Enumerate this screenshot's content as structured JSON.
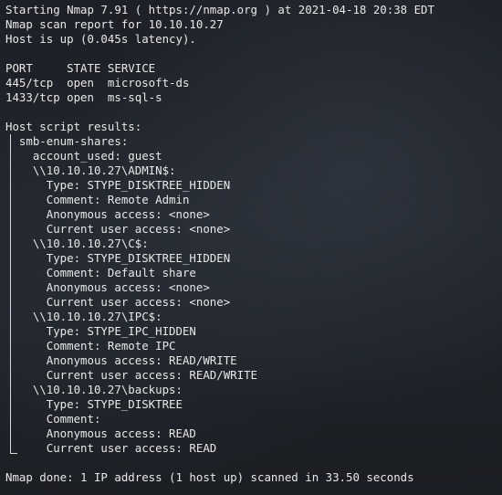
{
  "terminal": {
    "lines": {
      "l1": "Starting Nmap 7.91 ( https://nmap.org ) at 2021-04-18 20:38 EDT",
      "l2": "Nmap scan report for 10.10.10.27",
      "l3": "Host is up (0.045s latency).",
      "l5": "PORT     STATE SERVICE",
      "l6": "445/tcp  open  microsoft-ds",
      "l7": "1433/tcp open  ms-sql-s",
      "l9": "Host script results:",
      "l10": "  smb-enum-shares:",
      "l11": "    account_used: guest",
      "l12": "    \\\\10.10.10.27\\ADMIN$:",
      "l13": "      Type: STYPE_DISKTREE_HIDDEN",
      "l14": "      Comment: Remote Admin",
      "l15": "      Anonymous access: <none>",
      "l16": "      Current user access: <none>",
      "l17": "    \\\\10.10.10.27\\C$:",
      "l18": "      Type: STYPE_DISKTREE_HIDDEN",
      "l19": "      Comment: Default share",
      "l20": "      Anonymous access: <none>",
      "l21": "      Current user access: <none>",
      "l22": "    \\\\10.10.10.27\\IPC$:",
      "l23": "      Type: STYPE_IPC_HIDDEN",
      "l24": "      Comment: Remote IPC",
      "l25": "      Anonymous access: READ/WRITE",
      "l26": "      Current user access: READ/WRITE",
      "l27": "    \\\\10.10.10.27\\backups:",
      "l28": "      Type: STYPE_DISKTREE",
      "l29": "      Comment:",
      "l30": "      Anonymous access: READ",
      "l31": "      Current user access: READ",
      "l33": "Nmap done: 1 IP address (1 host up) scanned in 33.50 seconds"
    }
  }
}
